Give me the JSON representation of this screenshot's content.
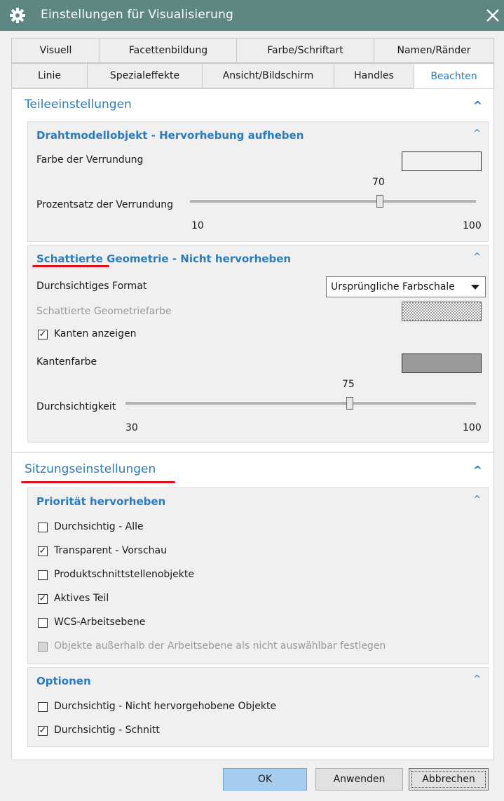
{
  "window": {
    "title": "Einstellungen für Visualisierung",
    "icon": "gear-icon",
    "close_icon": "close-icon"
  },
  "tabs": {
    "row1": [
      "Visuell",
      "Facettenbildung",
      "Farbe/Schriftart",
      "Namen/Ränder"
    ],
    "row2": [
      "Linie",
      "Spezialeffekte",
      "Ansicht/Bildschirm",
      "Handles",
      "Beachten"
    ],
    "active": "Beachten"
  },
  "teile": {
    "title": "Teileeinstellungen",
    "chevron": "^",
    "draht": {
      "title": "Drahtmodellobjekt - Hervorhebung aufheben",
      "chevron": "^",
      "farbe_label": "Farbe der Verrundung",
      "farbe_color": "#c8c8c8",
      "prozent_label": "Prozentsatz der Verrundung",
      "prozent_value": "70",
      "prozent_min": "10",
      "prozent_max": "100"
    },
    "schattiert": {
      "title": "Schattierte Geometrie - Nicht hervorheben",
      "chevron": "^",
      "format_label": "Durchsichtiges Format",
      "format_value": "Ursprüngliche Farbschale",
      "geofarbe_label": "Schattierte Geometriefarbe",
      "kanten_anzeigen": {
        "label": "Kanten anzeigen",
        "checked": true
      },
      "kantenfarbe_label": "Kantenfarbe",
      "kantenfarbe_color": "#9a9a9a",
      "durch_label": "Durchsichtigkeit",
      "durch_value": "75",
      "durch_min": "30",
      "durch_max": "100"
    }
  },
  "sitzung": {
    "title": "Sitzungseinstellungen",
    "chevron": "^",
    "prio": {
      "title": "Priorität hervorheben",
      "chevron": "^",
      "items": [
        {
          "label": "Durchsichtig - Alle",
          "checked": false,
          "disabled": false
        },
        {
          "label": "Transparent - Vorschau",
          "checked": true,
          "disabled": false
        },
        {
          "label": "Produktschnittstellenobjekte",
          "checked": false,
          "disabled": false
        },
        {
          "label": "Aktives Teil",
          "checked": true,
          "disabled": false
        },
        {
          "label": "WCS-Arbeitsebene",
          "checked": false,
          "disabled": false
        },
        {
          "label": "Objekte außerhalb der Arbeitsebene als nicht auswählbar festlegen",
          "checked": false,
          "disabled": true
        }
      ]
    },
    "optionen": {
      "title": "Optionen",
      "chevron": "^",
      "items": [
        {
          "label": "Durchsichtig - Nicht hervorgehobene Objekte",
          "checked": false,
          "disabled": false
        },
        {
          "label": "Durchsichtig - Schnitt",
          "checked": true,
          "disabled": false
        }
      ]
    }
  },
  "buttons": {
    "ok": "OK",
    "apply": "Anwenden",
    "cancel": "Abbrechen"
  },
  "accent": "#2a7bc0",
  "annotation_color": "#e0101a"
}
